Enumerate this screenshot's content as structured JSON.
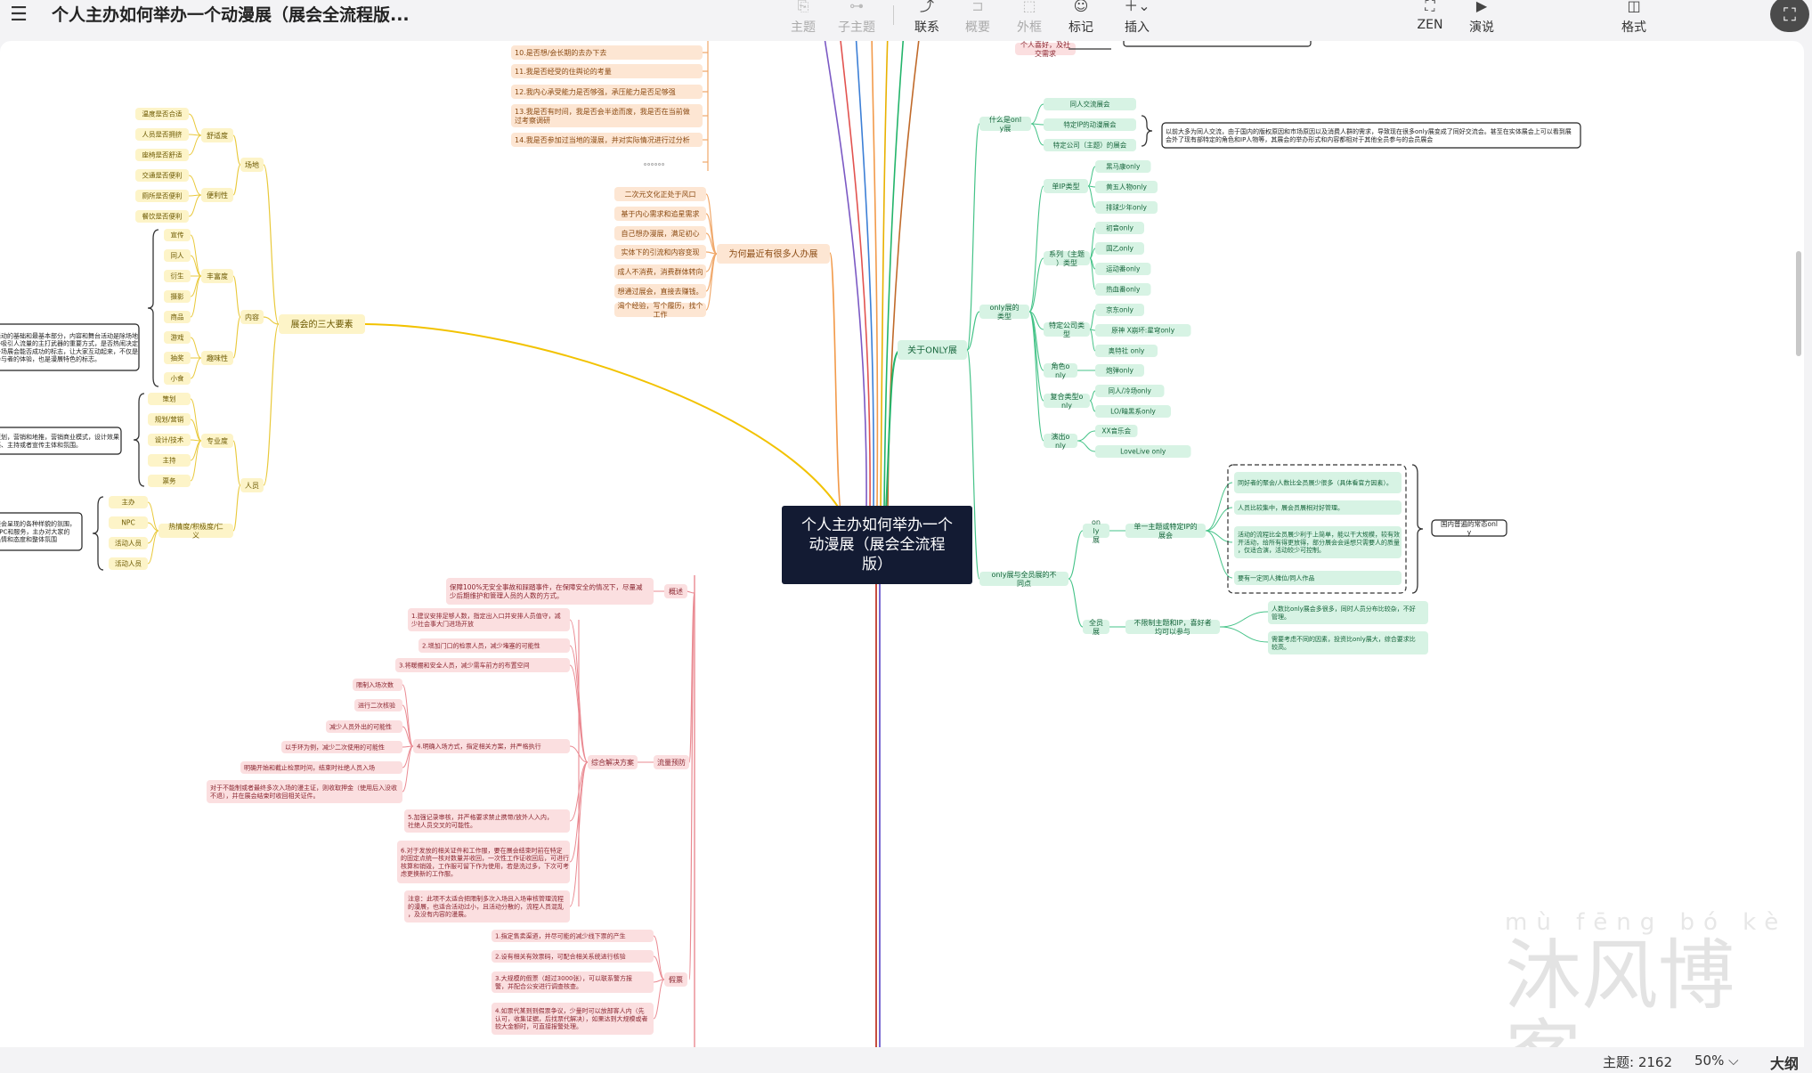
{
  "app": {
    "title": "个人主办如何举办一个动漫展（展会全流程版..."
  },
  "toolbar": {
    "topic": "主题",
    "subtopic": "子主题",
    "relation": "联系",
    "summary": "概要",
    "boundary": "外框",
    "marker": "标记",
    "insert": "插入",
    "zen": "ZEN",
    "pitch": "演说",
    "format": "格式"
  },
  "status": {
    "topics": "主题: 2162",
    "zoom": "50% ⌵",
    "outline": "大纲"
  },
  "watermark": {
    "pinyin": "mù fēng bó kè",
    "text": "沐风博客"
  },
  "colors": {
    "root": "#131b33",
    "yellow": "#f2c200",
    "orange": "#f29a4a",
    "green": "#23b46a",
    "red": "#e0606a",
    "purple": "#6a5acd"
  },
  "mindmap": {
    "root": "个人主办如何举办一个动漫展（展会全流程版）",
    "top_partial": {
      "n1": "个人喜好，及社交需求"
    },
    "why": {
      "label": "为何最近有很多人办展",
      "top": [
        "10.是否想/会长期的去办下去",
        "11.我是否经受的住舆论的考量",
        "12.我内心承受能力是否够强，承压能力是否足够强",
        "13.我是否有时间，我是否会半途而废，我是否在当前做过考察调研",
        "14.我是否参加过当地的漫展，并对实际情况进行过分析",
        "。。。。。。"
      ],
      "items": [
        "二次元文化正处于风口",
        "基于内心需求和追星需求",
        "自己想办漫展，满足初心",
        "实体下的引流和内容变现",
        "成人不消费，消费群体转向",
        "想通过展会，直接去赚钱。",
        "渴个经验，写个履历，找个工作"
      ]
    },
    "three": {
      "label": "展会的三大要素",
      "venue": "场地",
      "comfort": "舒适度",
      "comfort_items": [
        "温度是否合适",
        "人员是否拥挤",
        "座椅是否舒适"
      ],
      "convenience": "便利性",
      "conv_items": [
        "交通是否便利",
        "厕所是否便利",
        "餐饮是否便利"
      ],
      "content": "内容",
      "rich": "丰富度",
      "rich_items": [
        "宣传",
        "同人",
        "衍生",
        "摄影",
        "商品"
      ],
      "fun": "趣味性",
      "fun_items": [
        "游戏",
        "抽奖",
        "小食"
      ],
      "people": "人员",
      "pro": "专业度",
      "pro_items": [
        "策划",
        "规划/营销",
        "设计/技术",
        "主持",
        "票务"
      ],
      "hot": "热情度/积极度/仁义",
      "hot_items": [
        "主办",
        "NPC",
        "活动人员",
        "活动人员"
      ],
      "c1": "活动的基础和最基本部分，内容和舞台活动是除场地外吸引人流量的主打武器的重要方式，是否热闹决定一场展会能否成功的标志，让大家互动起来，不仅是参与者的体验，也是漫展特色的标志。",
      "c2": "策划，营销和地推，营销商业模式，设计效果感、主持或者宣传主体和氛围。",
      "c3": "展会呈现的各种样貌的氛围，NPC和服务，主办对大家的热情和态度和整体氛围"
    },
    "only": {
      "label": "关于ONLY展",
      "what": "什么是only展",
      "what_items": [
        "同人交流展会",
        "特定IP的动漫展会",
        "特定公司（主题）的展会"
      ],
      "desc": "以前大多为同人交流，由于国内的版权原因和市场原因以及消费人群的需求，导致现在很多only展变成了同好交流会。甚至在实体展会上可以看到展会外了现有部特定的角色和IP人物等，其展会的举办形式和内容都相对于其他全员参与的会员展会",
      "types": "only展的类型",
      "single": "单IP类型",
      "single_items": [
        "黑马康only",
        "黄五人物only",
        "排球少年only"
      ],
      "series": "系列（主题）类型",
      "series_items": [
        "初音only",
        "国乙only",
        "运动番only",
        "热血番only"
      ],
      "company": "特定公司类型",
      "company_items": [
        "京东only",
        "原神 X崩坏:星穹only",
        "奥特社 only"
      ],
      "role": "角色only",
      "role_items": [
        "炮弹only"
      ],
      "fusion": "复合类型only",
      "fusion_items": [
        "同人/冷场only",
        "LO/暗黑系only"
      ],
      "perf": "演出only",
      "perf_items": [
        "XX音乐会",
        "LoveLive only"
      ],
      "diff": "only展与全员展的不同点",
      "only_exhibit": "only展",
      "only_single": "单一主题或特定IP的展会",
      "only_notes": [
        "同好者的聚会/人数比全员展少很多（具体看官方因素）。",
        "人员比较集中，展会员展相对好管理。",
        "活动的流程比全员展少利于上简单，能以干大规模，较有效开活动，给所有得更放得，部分展会会遥想只需要人的质量，仅适合演，活动较少可控制。",
        "要有一定同人摊位/同人作品"
      ],
      "only_tag": "国内普遍的常态only",
      "all_exhibit": "全员展",
      "all_desc": "不限制主题和IP，喜好者均可以参与",
      "all_notes": [
        "人数比only展会多很多，同时人员分布比较杂，不好管理。",
        "需要考虑不同的因素，投资比only展大，综合要求比较高。"
      ]
    },
    "risk": {
      "overview": "概述",
      "overview_text": "保障100%无安全事故和踩踏事件，在保障安全的情况下，尽量减少后期维护和管理人员的人数的方式。",
      "prevention": "流量预防",
      "combined": "综合解决方案",
      "items": [
        "1.建议安排足够人数，指定出入口并安排人员值守，减少社会事大门进场开放",
        "2.增加门口的检票人员，减少堵塞的可能性",
        "3.将暖棚和安全人员，减少需车前方的布置空间",
        "4.明确入场方式，指定相关方案，并严格执行",
        "5.加强记录审核，并严格要求禁止携带/放外人入内，社绝人员交叉的可能性。",
        "6.对于发放的相关证件和工作服，要在展会结束时前在特定的固定点统一核对数量并收回，一次性工作证收回后，可进行核算和销毁，工作服可留下作为使用，若是洗过多，下次可考虑更换新的工作服。",
        "注意：此项不太适合把限制多次入场且入场审核管理流程的漫展，也适合活动过小，且活动分散的，流程人员混乱，及没有内容的漫展。"
      ],
      "sub_items": [
        "限制入场次数",
        "进行二次核验",
        "减少人员外出的可能性",
        "以手环为例，减少二次使用的可能性",
        "明确开始和截止检票时间，结束时社绝人员入场",
        "对于不能制或者最终多次入场的漫主证，则收取押金（使用后入没收不退），并在展会结束时收回相关证件。"
      ],
      "tickets": "假票",
      "ticket_items": [
        "1.指定售卖渠道，并尽可能的减少线下票的产生",
        "2.设有相关有效票码，可配合相关系统进行核验",
        "3.大规模的假票（超过3000张），可以联系警方报警，并配合公安进行调查核查。",
        "4.如票代某到到假票争议，少量时可以放部客人内（先认可，收集证据，后找票代解决），如果达到大规模或者较大金额时，可直接报警处理。"
      ]
    }
  }
}
